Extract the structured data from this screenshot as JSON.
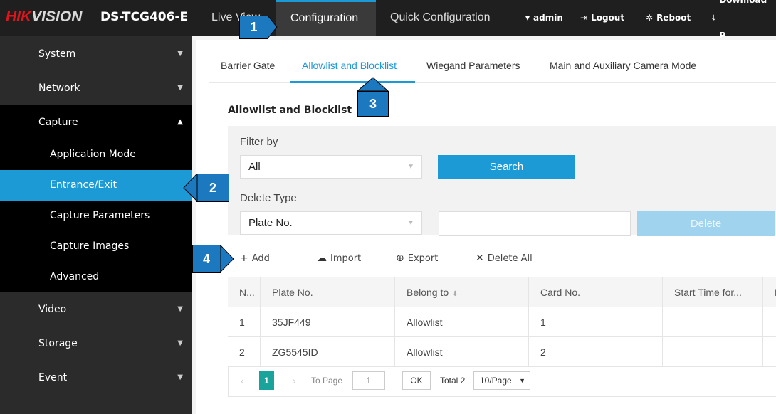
{
  "header": {
    "brand_prefix": "HIK",
    "brand_suffix": "VISION",
    "model": "DS-TCG406-E",
    "nav": [
      {
        "label": "Live View"
      },
      {
        "label": "Configuration"
      },
      {
        "label": "Quick Configuration"
      }
    ],
    "user": "admin",
    "logout": "Logout",
    "reboot": "Reboot",
    "download": "Download P",
    "icons": {
      "user": "user-icon",
      "logout": "logout-icon",
      "reboot": "reboot-icon",
      "download": "download-icon"
    }
  },
  "sidebar": {
    "items": [
      {
        "label": "System"
      },
      {
        "label": "Network"
      },
      {
        "label": "Capture"
      },
      {
        "label": "Video"
      },
      {
        "label": "Storage"
      },
      {
        "label": "Event"
      }
    ],
    "capture_sub": [
      {
        "label": "Application Mode"
      },
      {
        "label": "Entrance/Exit"
      },
      {
        "label": "Capture Parameters"
      },
      {
        "label": "Capture Images"
      },
      {
        "label": "Advanced"
      }
    ]
  },
  "tabs": [
    {
      "label": "Barrier Gate"
    },
    {
      "label": "Allowlist and Blocklist"
    },
    {
      "label": "Wiegand Parameters"
    },
    {
      "label": "Main and Auxiliary Camera Mode"
    }
  ],
  "section_title": "Allowlist and Blocklist",
  "filter": {
    "filter_by_label": "Filter by",
    "filter_by_value": "All",
    "search_label": "Search",
    "delete_type_label": "Delete Type",
    "delete_type_value": "Plate No.",
    "delete_input_value": "",
    "delete_label": "Delete"
  },
  "toolbar": {
    "add": "Add",
    "import": "Import",
    "export": "Export",
    "delete_all": "Delete All"
  },
  "table": {
    "headers": [
      "N...",
      "Plate No.",
      "Belong to",
      "Card No.",
      "Start Time for...",
      "E"
    ],
    "rows": [
      [
        "1",
        "35JF449",
        "Allowlist",
        "1",
        "",
        ""
      ],
      [
        "2",
        "ZG5545ID",
        "Allowlist",
        "2",
        "",
        ""
      ]
    ]
  },
  "pagination": {
    "current_page": "1",
    "to_page_label": "To Page",
    "to_page_value": "1",
    "ok_label": "OK",
    "total_label": "Total 2",
    "page_size": "10/Page"
  },
  "callouts": [
    "1",
    "2",
    "3",
    "4"
  ],
  "colors": {
    "accent": "#1c9ad6",
    "brand_red": "#e2141b",
    "sidebar_bg": "#2b2b2b",
    "topbar_bg": "#1f1f1f",
    "pager_active": "#1aa39a",
    "callout_bg": "#1c79c0"
  }
}
